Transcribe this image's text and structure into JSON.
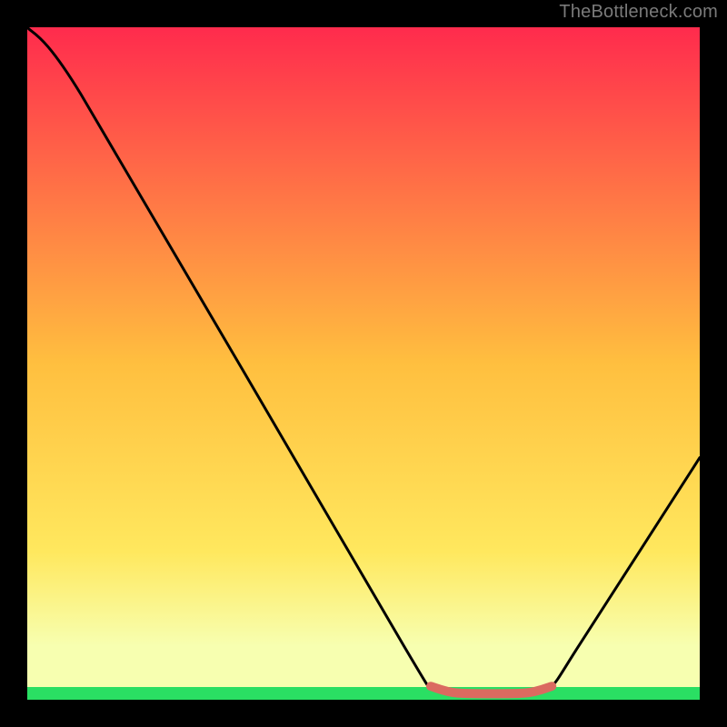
{
  "watermark": "TheBottleneck.com",
  "chart_data": {
    "type": "line",
    "title": "",
    "xlabel": "",
    "ylabel": "",
    "xlim": [
      0,
      100
    ],
    "ylim": [
      0,
      100
    ],
    "background_gradient": {
      "top_color": "#ff2b4d",
      "mid_color": "#ffe259",
      "bottom_bar_color": "#2adf63"
    },
    "series": [
      {
        "name": "bottleneck-curve",
        "color": "#000000",
        "points": [
          {
            "x": 0,
            "y": 100
          },
          {
            "x": 8,
            "y": 90
          },
          {
            "x": 56,
            "y": 8
          },
          {
            "x": 60,
            "y": 2
          },
          {
            "x": 64,
            "y": 1
          },
          {
            "x": 74,
            "y": 1
          },
          {
            "x": 78,
            "y": 2
          },
          {
            "x": 82,
            "y": 8
          },
          {
            "x": 100,
            "y": 36
          }
        ]
      },
      {
        "name": "highlighted-minimum",
        "color": "#db6a60",
        "points": [
          {
            "x": 60,
            "y": 2
          },
          {
            "x": 64,
            "y": 1
          },
          {
            "x": 74,
            "y": 1
          },
          {
            "x": 78,
            "y": 2
          }
        ]
      }
    ]
  }
}
